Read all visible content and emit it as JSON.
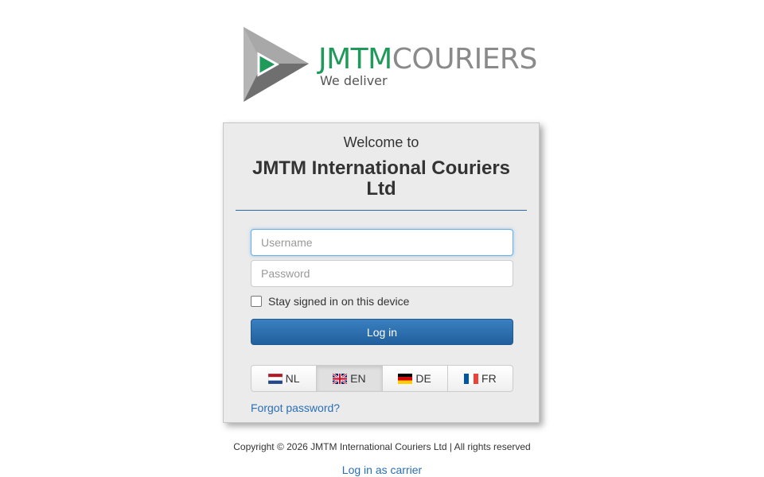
{
  "logo": {
    "brand": "JMTM",
    "rest": "COURIERS",
    "tagline": "We deliver",
    "colors": {
      "brand": "#1f9a5a",
      "rest": "#8a8a8a",
      "triangle": "#8c8c8c",
      "play": "#1f9a5a"
    }
  },
  "card": {
    "welcome": "Welcome to",
    "company": "JMTM International Couriers Ltd"
  },
  "form": {
    "username_placeholder": "Username",
    "username_value": "",
    "password_placeholder": "Password",
    "password_value": "",
    "remember_label": "Stay signed in on this device",
    "remember_checked": false,
    "login_label": "Log in"
  },
  "languages": [
    {
      "code": "NL",
      "flag": "flag-nl-icon",
      "active": false
    },
    {
      "code": "EN",
      "flag": "flag-gb-icon",
      "active": true
    },
    {
      "code": "DE",
      "flag": "flag-de-icon",
      "active": false
    },
    {
      "code": "FR",
      "flag": "flag-fr-icon",
      "active": false
    }
  ],
  "links": {
    "forgot": "Forgot password?",
    "carrier": "Log in as carrier"
  },
  "footer": {
    "copyright": "Copyright © 2026 JMTM International Couriers Ltd | All rights reserved"
  },
  "colors": {
    "accent": "#2a6fb5",
    "button": "#225f9e",
    "card_bg": "#ebebeb"
  }
}
